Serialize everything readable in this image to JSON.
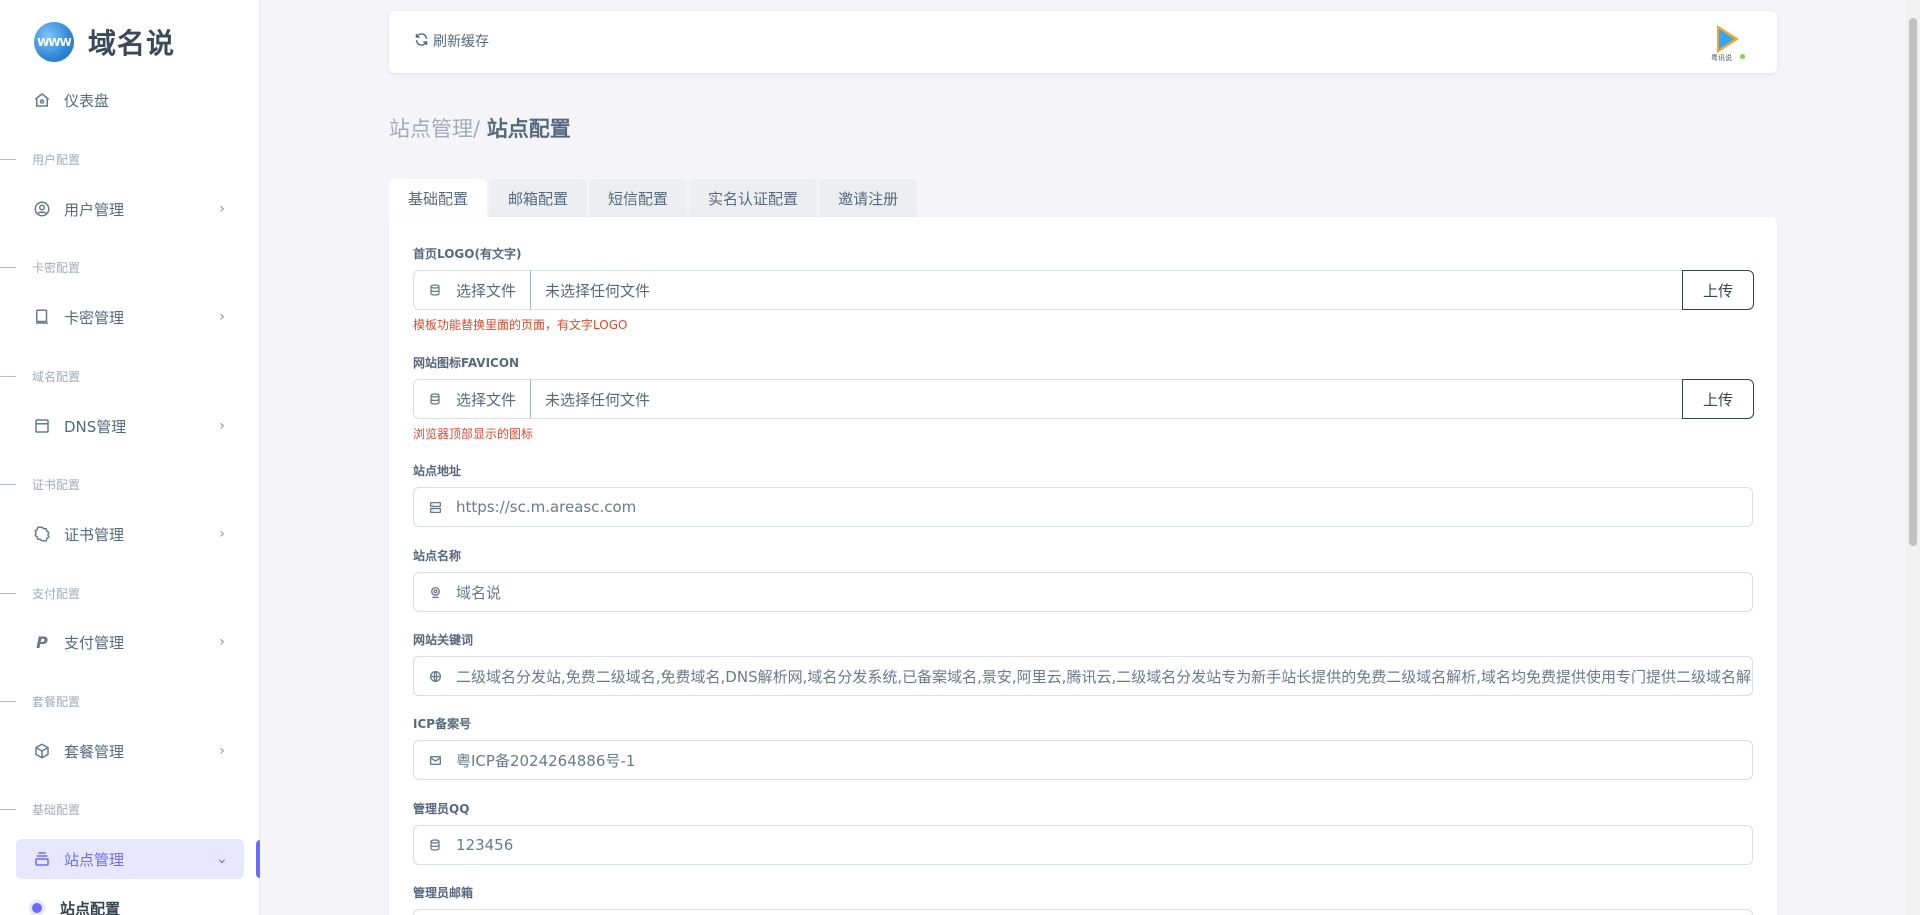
{
  "brand": {
    "logo_text": "WWW",
    "name": "域名说"
  },
  "sidebar": {
    "dashboard": "仪表盘",
    "sections": [
      {
        "header": "用户配置",
        "item": "用户管理"
      },
      {
        "header": "卡密配置",
        "item": "卡密管理"
      },
      {
        "header": "域名配置",
        "item": "DNS管理"
      },
      {
        "header": "证书配置",
        "item": "证书管理"
      },
      {
        "header": "支付配置",
        "item": "支付管理"
      },
      {
        "header": "套餐配置",
        "item": "套餐管理"
      },
      {
        "header": "基础配置",
        "item": "站点管理"
      }
    ],
    "active_sub_item": "站点配置"
  },
  "navbar": {
    "refresh_label": "刷新缓存",
    "avatar_caption": "粤讯说"
  },
  "breadcrumb": {
    "parent": "站点管理/",
    "current": "站点配置"
  },
  "tabs": [
    "基础配置",
    "邮箱配置",
    "短信配置",
    "实名认证配置",
    "邀请注册"
  ],
  "form": {
    "logo": {
      "label": "首页LOGO(有文字)",
      "choose_label": "选择文件",
      "file_name": "未选择任何文件",
      "upload_label": "上传",
      "help": "模板功能替换里面的页面，有文字LOGO"
    },
    "favicon": {
      "label": "网站图标FAVICON",
      "choose_label": "选择文件",
      "file_name": "未选择任何文件",
      "upload_label": "上传",
      "help": "浏览器顶部显示的图标"
    },
    "site_url": {
      "label": "站点地址",
      "value": "https://sc.m.areasc.com"
    },
    "site_name": {
      "label": "站点名称",
      "value": "域名说"
    },
    "keywords": {
      "label": "网站关键词",
      "value": "二级域名分发站,免费二级域名,免费域名,DNS解析网,域名分发系统,已备案域名,景安,阿里云,腾讯云,二级域名分发站专为新手站长提供的免费二级域名解析,域名均免费提供使用专门提供二级域名解"
    },
    "icp": {
      "label": "ICP备案号",
      "value": "粤ICP备2024264886号-1"
    },
    "admin_qq": {
      "label": "管理员QQ",
      "value": "123456"
    },
    "admin_email": {
      "label": "管理员邮箱"
    }
  },
  "colors": {
    "accent": "#696cff",
    "accent_bg": "#e7e7ff",
    "help_red": "#e0492f"
  }
}
